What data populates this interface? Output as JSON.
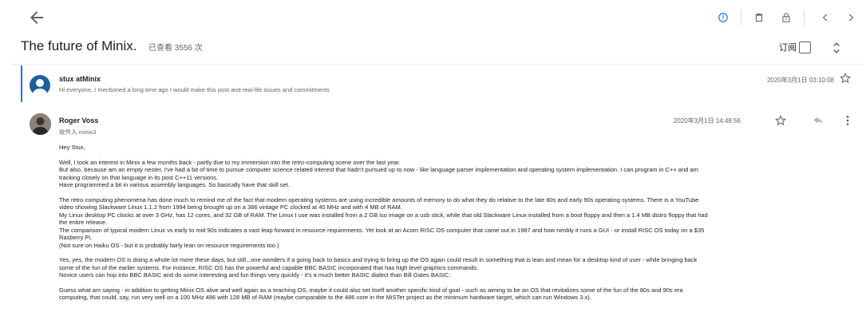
{
  "toolbar": {
    "back_icon": "arrow-back-icon",
    "icons": [
      "info-icon",
      "trash-icon",
      "lock-icon",
      "chevron-left-icon",
      "chevron-right-icon"
    ],
    "accent_color": "#1a73e8"
  },
  "thread": {
    "title": "The future of Minix.",
    "views": "已查看 3556 次",
    "subscribe_label": "订阅"
  },
  "message1": {
    "sender": "stux atMinix",
    "snippet": "Hi everyone, I mentioned a long time ago I would make this post and real-life issues and commitments",
    "date": "2020年3月1日 03:10:08"
  },
  "message2": {
    "sender": "Roger Voss",
    "recipient": "收件人 minix3",
    "date": "2020年3月1日 14:48:56",
    "greeting": "Hey Stux,",
    "para1": [
      "Well, I took an interest in Minix a few months back - partly due to my immersion into the retro-computing scene over the last year.",
      "But also, because am an empty nester, I've had a bit of time to pursue computer science related interest that hadn't pursued up to now - like language parser implementation and operating system implementation. I can program in C++ and am",
      "tracking closely on that language in its post C++11 versions.",
      "Have programmed a bit in various assembly languages. So basically have that skill set."
    ],
    "para2": [
      "The retro computing phenomena has done much to remind me of the fact that modern operating systems are using incredible amounts of memory to do what they do relative to the late 80s and early 90s operating systems. There is a YouTube",
      "video showing Slackware Linux 1.1.2 from 1994 being brought up on a 386 vintage PC clocked at 40 MHz and with 4 MB of RAM.",
      "My Linux desktop PC clocks at over 3 GHz, has 12 cores, and 32 GB of RAM. The Linux I use was installed from a 2 GB iso image on a usb stick, while that old Slackware Linux installed from a boot floppy and then a 1.4 MB distro floppy that had",
      "the entire release.",
      "The comparison of typical modern Linux vs early to mid 90s indicates a vast leap forward in resource requirements. Yet look at an Acorn RISC OS computer that came out in 1987 and how nimbly it runs a GUI - or install RISC OS today on a $35",
      "Rasberry Pi.",
      "(Not sure on Haiku OS - but it is probably fairly lean on resource requirements too.)"
    ],
    "para3": [
      "Yes, yes, the modern OS is doing a whole lot more these days, but still...one wonders if a going back to basics and trying to bring up the OS again could result in something that is lean and mean for a desktop kind of user - while bringing back",
      "some of the fun of the earlier systems. For instance, RISC OS has the powerful and capable BBC BASIC incorporated that has high level graphics commands.",
      "Novice users can hop into BBC BASIC and do some interesting and fun things very quickly - it's a much better BASIC dialect than Bill Gates BASIC."
    ],
    "para4": [
      "Guess what am saying - in addition to getting Minix OS alive and well again as a teaching OS, maybe it could also set itself another specific kind of goal - such as aiming to be an OS that revitalizes some of the fun of the 80s and 90s era",
      "computing, that could, say, run very well on a 100 MHz 486 with 128 MB of RAM (maybe comparable to the 486 core in the MiSTer project as the minimum hardware target, which can run Windows 3.x)."
    ]
  }
}
